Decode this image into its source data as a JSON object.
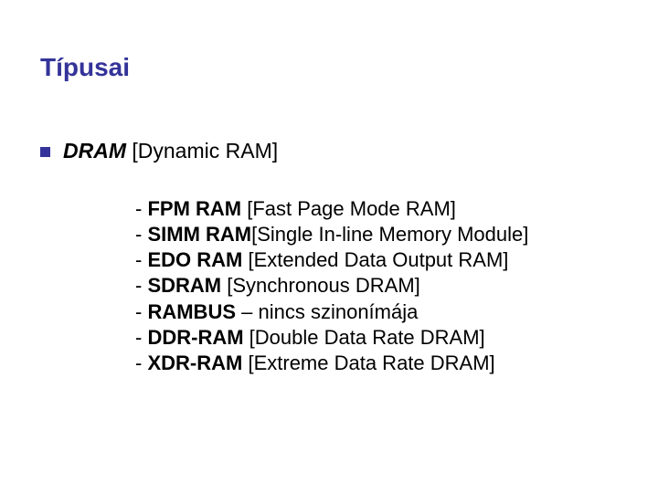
{
  "title": "Típusai",
  "heading": {
    "name": "DRAM",
    "desc": "[Dynamic RAM]"
  },
  "items": [
    {
      "dash": "- ",
      "name": "FPM RAM",
      "sep": " ",
      "desc": "[Fast Page Mode RAM]"
    },
    {
      "dash": "- ",
      "name": "SIMM RAM",
      "sep": "",
      "desc": "[Single In-line Memory Module]"
    },
    {
      "dash": "- ",
      "name": "EDO RAM",
      "sep": "  ",
      "desc": "[Extended Data Output RAM]"
    },
    {
      "dash": "- ",
      "name": "SDRAM",
      "sep": "      ",
      "desc": "[Synchronous DRAM]"
    },
    {
      "dash": "- ",
      "name": "RAMBUS",
      "sep": " – ",
      "desc": "nincs szinonímája"
    },
    {
      "dash": "- ",
      "name": "DDR-RAM",
      "sep": "  ",
      "desc": "[Double Data Rate DRAM]"
    },
    {
      "dash": "- ",
      "name": "XDR-RAM",
      "sep": "  ",
      "desc": "[Extreme Data Rate DRAM]"
    }
  ]
}
